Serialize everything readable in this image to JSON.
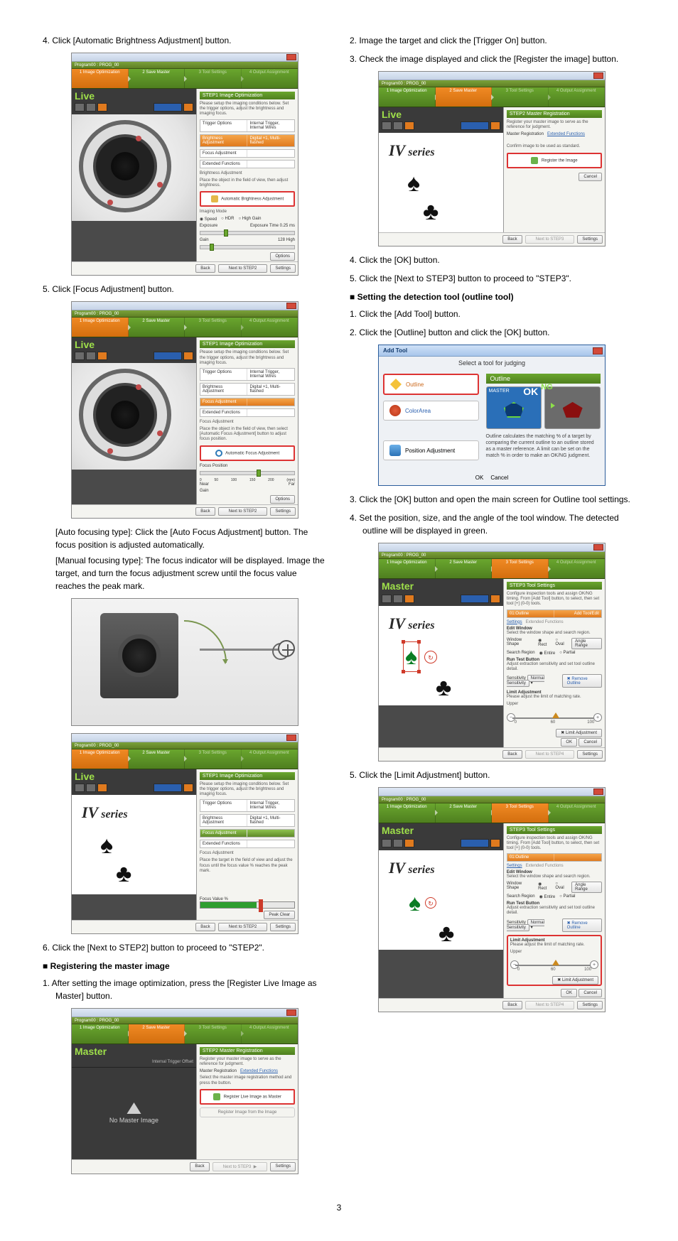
{
  "page_number": "3",
  "left": {
    "step4": "4.  Click [Automatic Brightness Adjustment] button.",
    "step5": "5.  Click [Focus Adjustment] button.",
    "autofocus_line": "[Auto focusing type]: Click the [Auto Focus Adjustment] button. The focus position is adjusted automatically.",
    "manualfocus_line": "[Manual focusing type]: The focus indicator will be displayed. Image the target, and turn the focus adjustment screw until the focus value reaches the peak mark.",
    "step6": "6.  Click the [Next to STEP2] button to proceed to \"STEP2\".",
    "heading_register": "Registering the master image",
    "step_reg1": "1.  After setting the image optimization, press the [Register Live Image as Master] button.",
    "fig_a": {
      "titlebar_prog": "Program00 : PROG_00",
      "right_head": "STEP1  Image Optimization",
      "right_hint": "Please setup the imaging conditions below.\nSet the trigger options, adjust the brightness and imaging focus.",
      "row_trigger_l": "Trigger Options",
      "row_trigger_r": "Internal Trigger, Internal Wires",
      "row_bright_l": "Brightness Adjustment",
      "row_bright_r": "Digital ×1, Multi-flashed",
      "row_focus_l": "Focus Adjustment",
      "row_ext_l": "Extended Functions",
      "bright_section": "Brightness Adjustment",
      "bright_hint": "Place the object in the field of view, then adjust brightness.",
      "auto_bright_btn": "Automatic Brightness Adjustment",
      "imaging_mode": "Imaging Mode",
      "mode_speed": "Speed",
      "mode_hdr": "HDR",
      "mode_high": "High Gain",
      "exposure": "Exposure",
      "exposure_val": "Exposure Time  0.25 ms",
      "gain": "Gain",
      "gain_val": "128  High",
      "options_btn": "Options",
      "live": "Live",
      "wiz1": "1\nImage\nOptimization",
      "wiz2": "2\nSave Master",
      "wiz3": "3\nTool\nSettings",
      "wiz4": "4\nOutput\nAssignment",
      "back": "Back",
      "next": "Next to STEP2",
      "settings": "Settings"
    },
    "fig_b": {
      "focus_section": "Focus Adjustment",
      "auto_focus_btn": "Automatic Focus Adjustment",
      "focus_hint": "Place the object in the field of view, then select [Automatic Focus Adjustment] button to adjust focus position.",
      "focus_position": "Focus Position",
      "ticks": [
        "0",
        "50",
        "100",
        "150",
        "200",
        "(mm)"
      ],
      "near": "Near",
      "far": "Far",
      "gain2": "Gain"
    },
    "fig_c": {
      "manual_hint": "Place the target in the field of view and adjust the focus until the focus value % reaches the peak mark.",
      "focus_value": "Focus Value %",
      "peak_clear": "Peak Clear"
    },
    "fig_d": {
      "right_head": "STEP2  Master Registration",
      "hint_top": "Register your master image to serve as the reference for judgment.",
      "master_reg": "Master Registration",
      "master_reg_btn": "Extended Functions",
      "hint_sel": "Select the master image registration method and press the button.",
      "reg_btn": "Register Live Image as Master",
      "reg_file": "Register Image from the Image",
      "master_label": "Master",
      "no_master": "No Master Image"
    },
    "iv_text": "IV series"
  },
  "right": {
    "step2": "2.  Image the target and click the [Trigger On] button.",
    "step3": "3.  Check the image displayed and click the [Register the image] button.",
    "step4r": "4.  Click the [OK] button.",
    "step5r": "5.  Click the [Next to STEP3] button to proceed to \"STEP3\".",
    "heading_detect": "Setting the detection tool (outline tool)",
    "det1": "1.  Click the [Add Tool] button.",
    "det2": "2.  Click the [Outline] button and click the [OK] button.",
    "det3": "3.  Click the [OK] button and open the main screen for Outline tool settings.",
    "det4": "4.  Set the position, size, and the angle of the tool window. The detected outline will be displayed in green.",
    "det5": "5.  Click the [Limit Adjustment] button.",
    "fig_e": {
      "right_head": "STEP2  Master Registration",
      "hint": "Register your master image to serve as the reference for judgment.",
      "master_reg": "Master Registration",
      "ext_func": "Extended Functions",
      "confirm": "Confirm image to be used as standard.",
      "reg_image": "Register the Image",
      "cancel": "Cancel",
      "back": "Back",
      "next": "Next to STEP3",
      "settings": "Settings"
    },
    "addtool": {
      "title": "Add Tool",
      "subtitle": "Select a tool for judging",
      "tool_outline": "Outline",
      "tool_colorarea": "ColorArea",
      "tool_pos": "Position Adjustment",
      "preview_head": "Outline",
      "label_master": "MASTER",
      "label_ok": "OK",
      "label_ng": "NG",
      "desc": "Outline calculates the matching % of a target by comparing the current outline to an outline stored as a master reference.\nA limit can be set on the match % in order to make an OK/NG judgment.",
      "ok": "OK",
      "cancel": "Cancel"
    },
    "fig_f": {
      "right_head": "STEP3  Tool Settings",
      "hint": "Configure inspection tools and assign OK/NG timing.\nFrom [Add Tool] button, to select, then set tool [+] (0-0) tools.",
      "t1_outline": "01:Outline",
      "add_tool_btn": "Add Tool/Edit",
      "settings_tab": "Settings",
      "ext_tab": "Extended Functions",
      "edit_window": "Edit Window",
      "edit_window_hint": "Select the window shape and search region.",
      "window_shape": "Window Shape",
      "shape_rect": "Rect",
      "shape_oval": "Oval",
      "search_region": "Search Region",
      "sr_entire": "Entire",
      "sr_partial": "Partial",
      "angle_range": "Angle Range",
      "run_test": "Run Test Button",
      "run_hint": "Adjust extraction sensitivity and set tool outline detail.",
      "sensitivity": "Sensitivity",
      "normal_sens": "Normal Sensitivity",
      "remove_outline": "Remove Outline",
      "limit_adj": "Limit Adjustment",
      "limit_hint": "Please adjust the limit of matching rate.",
      "upper": "Upper",
      "zero": "0",
      "sixty": "60",
      "hundred": "100",
      "limit_adj_btn": "Limit Adjustment",
      "ok": "OK",
      "cancel": "Cancel",
      "back": "Back",
      "next": "Next to STEP4",
      "settings_btm": "Settings"
    },
    "fig_g": {
      "master_label": "Master"
    }
  }
}
